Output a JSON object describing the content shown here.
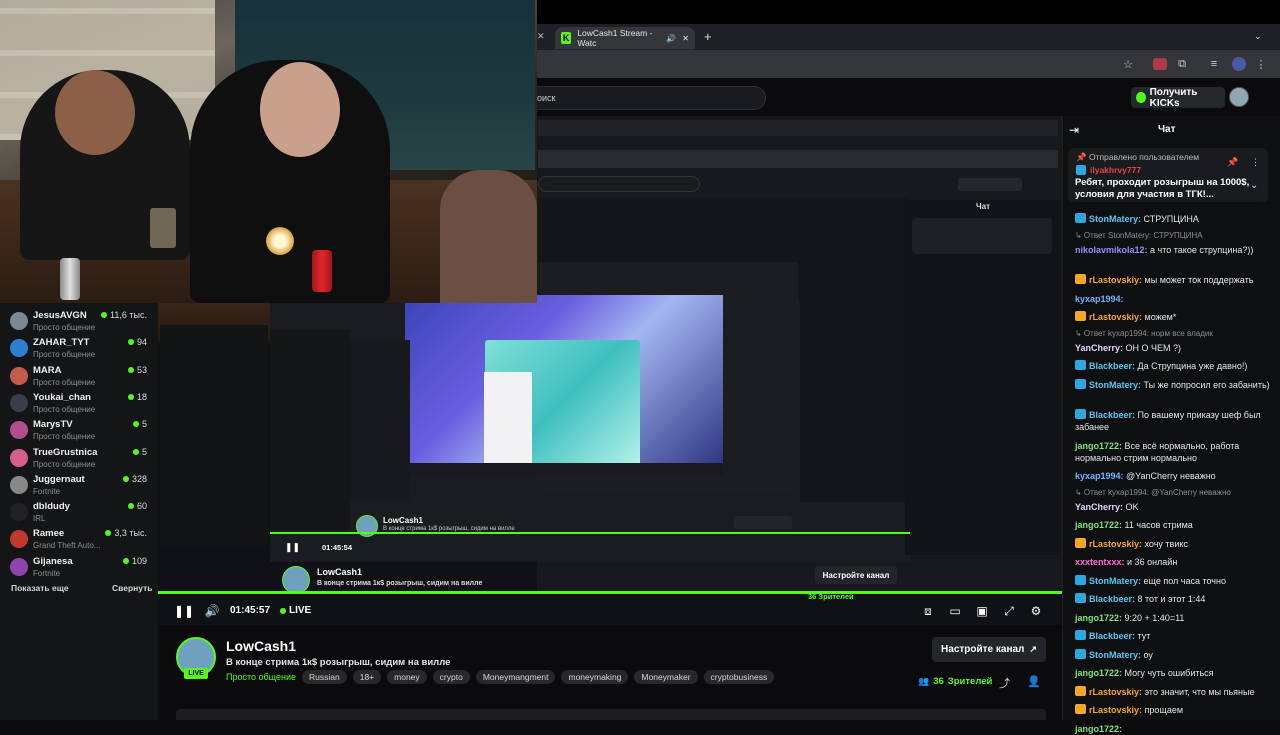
{
  "browser": {
    "tab_title": "LowCash1 Stream - Watc",
    "tab_close": "✕",
    "new_tab": "+"
  },
  "header": {
    "search_text": "оиск",
    "get_kicks": "Получить KICKs"
  },
  "sidebar": {
    "items": [
      {
        "name": "JesusAVGN",
        "category": "Просто общение",
        "viewers": "11,6 тыс.",
        "color": "#7a8794"
      },
      {
        "name": "ZAHAR_TYT",
        "category": "Просто общение",
        "viewers": "94",
        "color": "#2f7fd0"
      },
      {
        "name": "MARA",
        "category": "Просто общение",
        "viewers": "53",
        "color": "#c25b4a"
      },
      {
        "name": "Youkai_chan",
        "category": "Просто общение",
        "viewers": "18",
        "color": "#3c3c4a"
      },
      {
        "name": "MarysTV",
        "category": "Просто общение",
        "viewers": "5",
        "color": "#b04f8c"
      },
      {
        "name": "TrueGrustnica",
        "category": "Просто общение",
        "viewers": "5",
        "color": "#d35f8a"
      },
      {
        "name": "Juggernaut",
        "category": "Fortnite",
        "viewers": "328",
        "color": "#888888"
      },
      {
        "name": "dbldudy",
        "category": "IRL",
        "viewers": "60",
        "color": "#222226"
      },
      {
        "name": "Ramee",
        "category": "Grand Theft Auto...",
        "viewers": "3,3 тыс.",
        "color": "#c0392b"
      },
      {
        "name": "Gijanesa",
        "category": "Fortnite",
        "viewers": "109",
        "color": "#8e44ad"
      }
    ],
    "show_more": "Показать еще",
    "collapse": "Свернуть"
  },
  "player": {
    "time": "01:45:57",
    "live": "LIVE",
    "progress": 1.0,
    "inner_name": "LowCash1",
    "inner_title": "В конце стрима 1к$ розыгрыш, сидим на вилле",
    "inner_time": "01:45:54",
    "inner_setup": "Настройте канал",
    "inner_viewers": "36 Зрителей",
    "inner_chat_title": "Чат"
  },
  "stream": {
    "name": "LowCash1",
    "title": "В конце стрима 1к$ розыгрыш, сидим на вилле",
    "category": "Просто общение",
    "tags": [
      "Russian",
      "18+",
      "money",
      "crypto",
      "Moneymangment",
      "moneymaking",
      "Moneymaker",
      "cryptobusiness"
    ],
    "live_badge": "LIVE",
    "setup_button": "Настройте канал",
    "viewers_count": "36",
    "viewers_label": "Зрителей"
  },
  "chat": {
    "title": "Чат",
    "pinned_label": "Отправлено пользователем",
    "pinned_user": "ilyakhrvy777",
    "pinned_text": "Ребят, проходит розыгрыш на 1000$, условия для участия в ТГК!...",
    "messages": [
      {
        "user": "StonMatery",
        "text": "СТРУПЦИНА",
        "color": "#53c8f5",
        "badge": "#2aa9e0"
      },
      {
        "reply": "Ответ StonMatery: СТРУПЦИНА",
        "user": "nikolavmikola12",
        "text": "а что такое струпцина?))",
        "color": "#9b8cff"
      },
      {
        "user": "rLastovskiy",
        "text": "мы может ток поддержать",
        "color": "#f5a623",
        "badge": "#f5a623"
      },
      {
        "user": "kyxap1994",
        "text": "",
        "color": "#6fb5ff"
      },
      {
        "user": "rLastovskiy",
        "text": "можем*",
        "color": "#f5a623",
        "badge": "#f5a623"
      },
      {
        "reply": "Ответ kyxap1994: норм все владик",
        "user": "YanCherry",
        "text": "ОН О ЧЕМ ?)",
        "color": "#e6d2ff"
      },
      {
        "user": "Blackbeer",
        "text": "Да Струпцина уже давно!)",
        "color": "#53c8f5",
        "badge": "#2aa9e0"
      },
      {
        "user": "StonMatery",
        "text": "Ты же попросил его забанить)",
        "color": "#53c8f5",
        "badge": "#2aa9e0"
      },
      {
        "user": "Blackbeer",
        "text": "По вашему приказу шеф был забанее",
        "color": "#53c8f5",
        "badge": "#2aa9e0"
      },
      {
        "user": "jango1722",
        "text": "Все всё нормально, работа нормально стрим нормально",
        "color": "#7fe37f"
      },
      {
        "user": "kyxap1994",
        "text": "@YanCherry неважно",
        "color": "#6fb5ff"
      },
      {
        "reply": "Ответ kyxap1994: @YanCherry неважно",
        "user": "YanCherry",
        "text": "OK",
        "color": "#e6d2ff"
      },
      {
        "user": "jango1722",
        "text": "11 часов стрима",
        "color": "#7fe37f"
      },
      {
        "user": "rLastovskiy",
        "text": "хочу твикс",
        "color": "#f5a623",
        "badge": "#f5a623"
      },
      {
        "user": "xxxtentxxx",
        "text": "и 36 онлайн",
        "color": "#ff6bd8"
      },
      {
        "user": "StonMatery",
        "text": "еще пол часа точно",
        "color": "#53c8f5",
        "badge": "#2aa9e0"
      },
      {
        "user": "Blackbeer",
        "text": "8 тот и этот 1:44",
        "color": "#53c8f5",
        "badge": "#2aa9e0"
      },
      {
        "user": "jango1722",
        "text": "9:20 + 1:40=11",
        "color": "#7fe37f"
      },
      {
        "user": "Blackbeer",
        "text": "тут",
        "color": "#53c8f5",
        "badge": "#2aa9e0"
      },
      {
        "user": "StonMatery",
        "text": "оу",
        "color": "#53c8f5",
        "badge": "#2aa9e0"
      },
      {
        "user": "jango1722",
        "text": "Могу чуть ошибиться",
        "color": "#7fe37f"
      },
      {
        "user": "rLastovskiy",
        "text": "это значит, что мы пьяные",
        "color": "#f5a623",
        "badge": "#f5a623"
      },
      {
        "user": "rLastovskiy",
        "text": "прощаем",
        "color": "#f5a623",
        "badge": "#f5a623"
      },
      {
        "user": "jango1722",
        "text": "",
        "color": "#7fe37f"
      }
    ]
  },
  "colors": {
    "accent": "#53fc18",
    "background": "#0b0b0d"
  }
}
